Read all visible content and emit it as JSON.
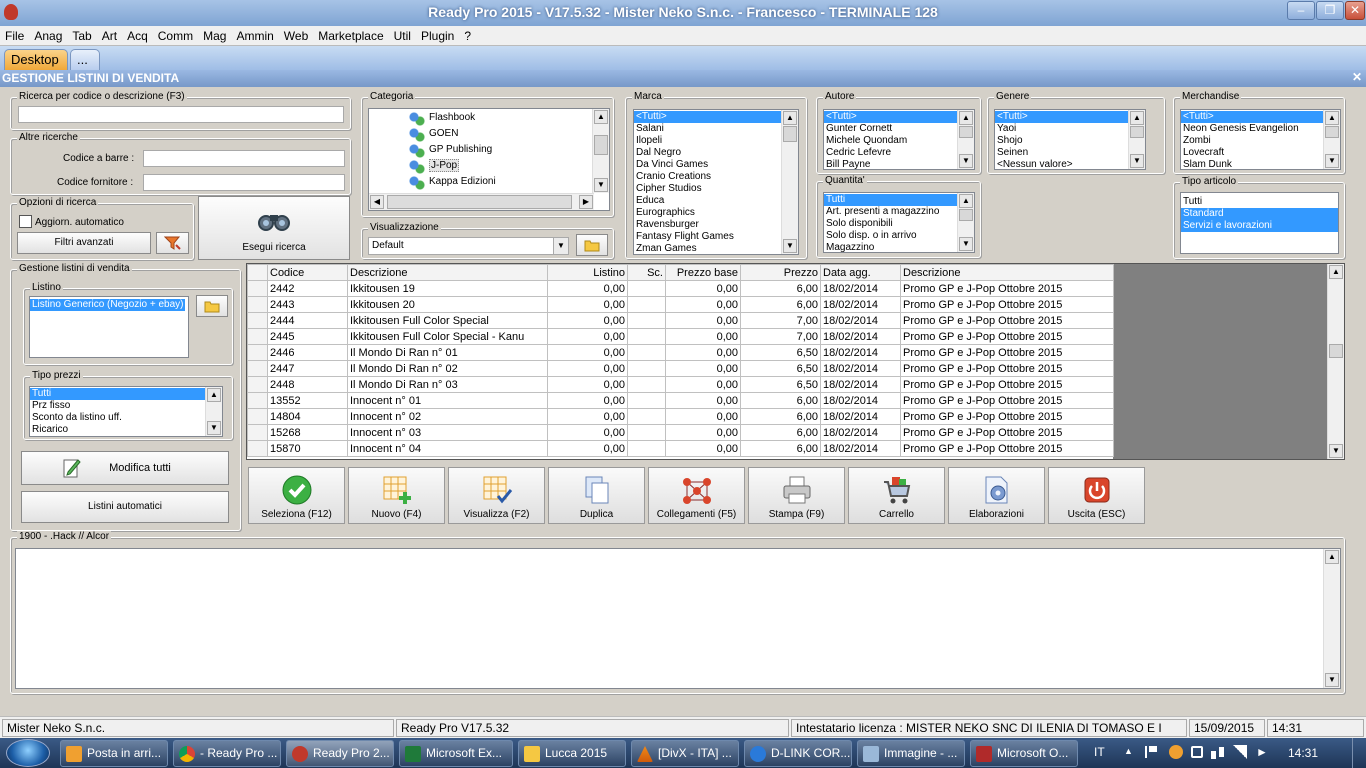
{
  "window": {
    "title": "Ready Pro 2015 - V17.5.32 - Mister Neko S.n.c. - Francesco - TERMINALE 128"
  },
  "menu": [
    "File",
    "Anag",
    "Tab",
    "Art",
    "Acq",
    "Comm",
    "Mag",
    "Ammin",
    "Web",
    "Marketplace",
    "Util",
    "Plugin",
    "?"
  ],
  "tabs": {
    "desktop": "Desktop",
    "more": "..."
  },
  "section_title": "GESTIONE LISTINI DI VENDITA",
  "search": {
    "code_label": "Ricerca per codice o descrizione (F3)",
    "other_label": "Altre ricerche",
    "barcode_label": "Codice a barre :",
    "supplier_label": "Codice fornitore :",
    "options_label": "Opzioni di ricerca",
    "auto_update": "Aggiorn. automatico",
    "advanced": "Filtri avanzati",
    "run": "Esegui ricerca"
  },
  "categoria": {
    "label": "Categoria",
    "items": [
      "Flashbook",
      "GOEN",
      "GP Publishing",
      "J-Pop",
      "Kappa Edizioni"
    ],
    "selected": "J-Pop"
  },
  "visualizzazione": {
    "label": "Visualizzazione",
    "value": "Default"
  },
  "marca": {
    "label": "Marca",
    "items": [
      "<Tutti>",
      "Salani",
      "Ilopeli",
      "Dal Negro",
      "Da Vinci Games",
      "Cranio Creations",
      "Cipher Studios",
      "Educa",
      "Eurographics",
      "Ravensburger",
      "Fantasy Flight Games",
      "Zman Games"
    ]
  },
  "autore": {
    "label": "Autore",
    "items": [
      "<Tutti>",
      "Gunter Cornett",
      "Michele Quondam",
      "Cedric Lefevre",
      "Bill Payne"
    ]
  },
  "genere": {
    "label": "Genere",
    "items": [
      "<Tutti>",
      "Yaoi",
      "Shojo",
      "Seinen",
      "<Nessun valore>"
    ]
  },
  "merchandise": {
    "label": "Merchandise",
    "items": [
      "<Tutti>",
      "Neon Genesis Evangelion",
      "Zombi",
      "Lovecraft",
      "Slam Dunk"
    ]
  },
  "quantita": {
    "label": "Quantita'",
    "items": [
      "Tutti",
      "Art. presenti a magazzino",
      "Solo disponibili",
      "Solo disp. o in arrivo",
      "Magazzino"
    ]
  },
  "tipo_articolo": {
    "label": "Tipo articolo",
    "items": [
      "Tutti",
      "Standard",
      "Servizi e lavorazioni"
    ]
  },
  "gestione": {
    "label": "Gestione listini di vendita",
    "listino_label": "Listino",
    "listino_value": "Listino Generico (Negozio + ebay)",
    "tipo_prezzi_label": "Tipo prezzi",
    "tipo_prezzi": [
      "Tutti",
      "Prz fisso",
      "Sconto da listino uff.",
      "Ricarico"
    ],
    "modifica": "Modifica tutti",
    "automatici": "Listini automatici"
  },
  "grid": {
    "headers": [
      "Codice",
      "Descrizione",
      "Listino",
      "Sc.",
      "Prezzo base",
      "Prezzo",
      "Data agg.",
      "Descrizione"
    ],
    "rows": [
      [
        "2442",
        "Ikkitousen 19",
        "0,00",
        "",
        "0,00",
        "6,00",
        "18/02/2014",
        "Promo GP e J-Pop Ottobre 2015"
      ],
      [
        "2443",
        "Ikkitousen 20",
        "0,00",
        "",
        "0,00",
        "6,00",
        "18/02/2014",
        "Promo GP e J-Pop Ottobre 2015"
      ],
      [
        "2444",
        "Ikkitousen Full Color Special",
        "0,00",
        "",
        "0,00",
        "7,00",
        "18/02/2014",
        "Promo GP e J-Pop Ottobre 2015"
      ],
      [
        "2445",
        "Ikkitousen Full Color Special - Kanu",
        "0,00",
        "",
        "0,00",
        "7,00",
        "18/02/2014",
        "Promo GP e J-Pop Ottobre 2015"
      ],
      [
        "2446",
        "Il Mondo Di Ran n° 01",
        "0,00",
        "",
        "0,00",
        "6,50",
        "18/02/2014",
        "Promo GP e J-Pop Ottobre 2015"
      ],
      [
        "2447",
        "Il Mondo Di Ran n° 02",
        "0,00",
        "",
        "0,00",
        "6,50",
        "18/02/2014",
        "Promo GP e J-Pop Ottobre 2015"
      ],
      [
        "2448",
        "Il Mondo Di Ran n° 03",
        "0,00",
        "",
        "0,00",
        "6,50",
        "18/02/2014",
        "Promo GP e J-Pop Ottobre 2015"
      ],
      [
        "13552",
        "Innocent n° 01",
        "0,00",
        "",
        "0,00",
        "6,00",
        "18/02/2014",
        "Promo GP e J-Pop Ottobre 2015"
      ],
      [
        "14804",
        "Innocent n° 02",
        "0,00",
        "",
        "0,00",
        "6,00",
        "18/02/2014",
        "Promo GP e J-Pop Ottobre 2015"
      ],
      [
        "15268",
        "Innocent n° 03",
        "0,00",
        "",
        "0,00",
        "6,00",
        "18/02/2014",
        "Promo GP e J-Pop Ottobre 2015"
      ],
      [
        "15870",
        "Innocent n° 04",
        "0,00",
        "",
        "0,00",
        "6,00",
        "18/02/2014",
        "Promo GP e J-Pop Ottobre 2015"
      ]
    ]
  },
  "toolbar": {
    "seleziona": "Seleziona (F12)",
    "nuovo": "Nuovo (F4)",
    "visualizza": "Visualizza (F2)",
    "duplica": "Duplica",
    "collegamenti": "Collegamenti (F5)",
    "stampa": "Stampa (F9)",
    "carrello": "Carrello",
    "elaborazioni": "Elaborazioni",
    "uscita": "Uscita (ESC)"
  },
  "notes": {
    "label": "1900 - .Hack // Alcor"
  },
  "status": {
    "company": "Mister Neko S.n.c.",
    "version": "Ready Pro V17.5.32",
    "license": "Intestatario licenza : MISTER NEKO SNC DI ILENIA DI TOMASO E I",
    "date": "15/09/2015",
    "time": "14:31"
  },
  "taskbar": {
    "items": [
      "Posta in arri...",
      "- Ready Pro ...",
      "Ready Pro 2...",
      "Microsoft Ex...",
      "Lucca 2015",
      "[DivX - ITA] ...",
      "D-LINK COR...",
      "Immagine - ...",
      "Microsoft O..."
    ],
    "lang": "IT",
    "clock": "14:31"
  },
  "colors": {
    "selection": "#3399ff",
    "title": "#7fa4d3",
    "desktop_tab": "#f5b34a"
  }
}
